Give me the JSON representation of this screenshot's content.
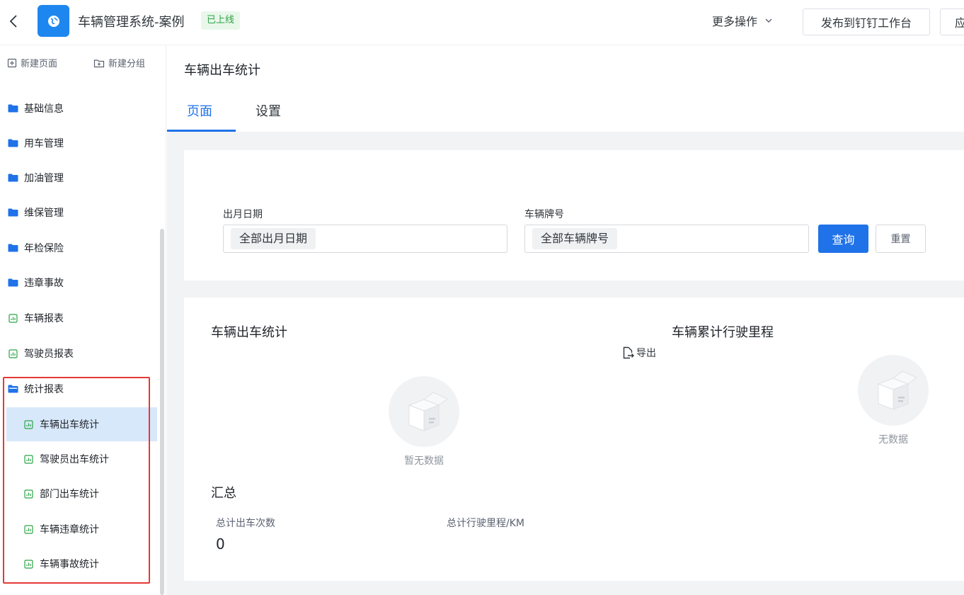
{
  "header": {
    "app_title": "车辆管理系统-案例",
    "status_badge": "已上线",
    "more_actions": "更多操作",
    "publish_button": "发布到钉钉工作台",
    "app_button": "应"
  },
  "sidebar": {
    "new_page": "新建页面",
    "new_group": "新建分组",
    "items": [
      {
        "label": "基础信息",
        "icon": "folder-icon"
      },
      {
        "label": "用车管理",
        "icon": "folder-icon"
      },
      {
        "label": "加油管理",
        "icon": "folder-icon"
      },
      {
        "label": "维保管理",
        "icon": "folder-icon"
      },
      {
        "label": "年检保险",
        "icon": "folder-icon"
      },
      {
        "label": "违章事故",
        "icon": "folder-icon"
      },
      {
        "label": "车辆报表",
        "icon": "report-icon"
      },
      {
        "label": "驾驶员报表",
        "icon": "report-icon"
      },
      {
        "label": "统计报表",
        "icon": "folder-open-icon"
      }
    ],
    "sub_items": [
      {
        "label": "车辆出车统计",
        "active": true
      },
      {
        "label": "驾驶员出车统计"
      },
      {
        "label": "部门出车统计"
      },
      {
        "label": "车辆违章统计"
      },
      {
        "label": "车辆事故统计"
      }
    ]
  },
  "page": {
    "title": "车辆出车统计",
    "tabs": [
      {
        "label": "页面",
        "active": true
      },
      {
        "label": "设置"
      }
    ]
  },
  "filters": {
    "date_label": "出月日期",
    "date_value": "全部出月日期",
    "plate_label": "车辆牌号",
    "plate_value": "全部车辆牌号",
    "query_button": "查询",
    "reset_button": "重置"
  },
  "stats": {
    "chart1_title": "车辆出车统计",
    "chart1_empty": "暂无数据",
    "export_label": "导出",
    "chart2_title": "车辆累计行驶里程",
    "chart2_empty": "无数据",
    "summary_title": "汇总",
    "total_trips_label": "总计出车次数",
    "total_trips_value": "0",
    "total_mileage_label": "总计行驶里程/KM"
  },
  "colors": {
    "primary": "#1f72e8",
    "badge_bg": "#e9f7ea",
    "badge_text": "#2ba346",
    "highlight": "#e53935"
  }
}
